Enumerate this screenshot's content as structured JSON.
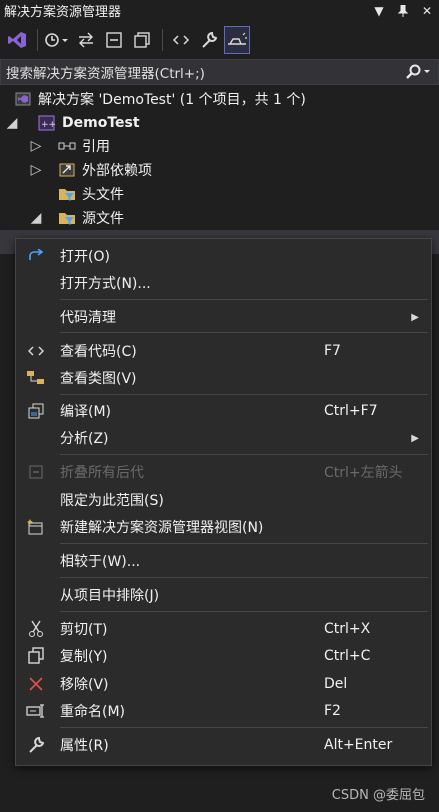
{
  "window": {
    "title": "解决方案资源管理器"
  },
  "search": {
    "placeholder": "搜索解决方案资源管理器(Ctrl+;)"
  },
  "tree": {
    "solution": "解决方案 'DemoTest' (1 个项目，共 1 个)",
    "project": "DemoTest",
    "nodes": [
      "引用",
      "外部依赖项",
      "头文件",
      "源文件"
    ]
  },
  "menu": {
    "open": "打开(O)",
    "open_with": "打开方式(N)...",
    "code_cleanup": "代码清理",
    "view_code": "查看代码(C)",
    "view_code_key": "F7",
    "view_class_diagram": "查看类图(V)",
    "compile": "编译(M)",
    "compile_key": "Ctrl+F7",
    "analyze": "分析(Z)",
    "collapse_all": "折叠所有后代",
    "collapse_all_key": "Ctrl+左箭头",
    "scope_to_this": "限定为此范围(S)",
    "new_view": "新建解决方案资源管理器视图(N)",
    "compare_with": "相较于(W)...",
    "exclude": "从项目中排除(J)",
    "cut": "剪切(T)",
    "cut_key": "Ctrl+X",
    "copy": "复制(Y)",
    "copy_key": "Ctrl+C",
    "remove": "移除(V)",
    "remove_key": "Del",
    "rename": "重命名(M)",
    "rename_key": "F2",
    "properties": "属性(R)",
    "properties_key": "Alt+Enter"
  },
  "watermark": "CSDN @委屈包",
  "colors": {
    "background": "#1f1f1f",
    "menu": "#2b2b2b",
    "accent": "#5c6bc0",
    "remove_icon": "#e05050",
    "folder": "#d9b35b",
    "vs_purple": "#8a63d2"
  }
}
